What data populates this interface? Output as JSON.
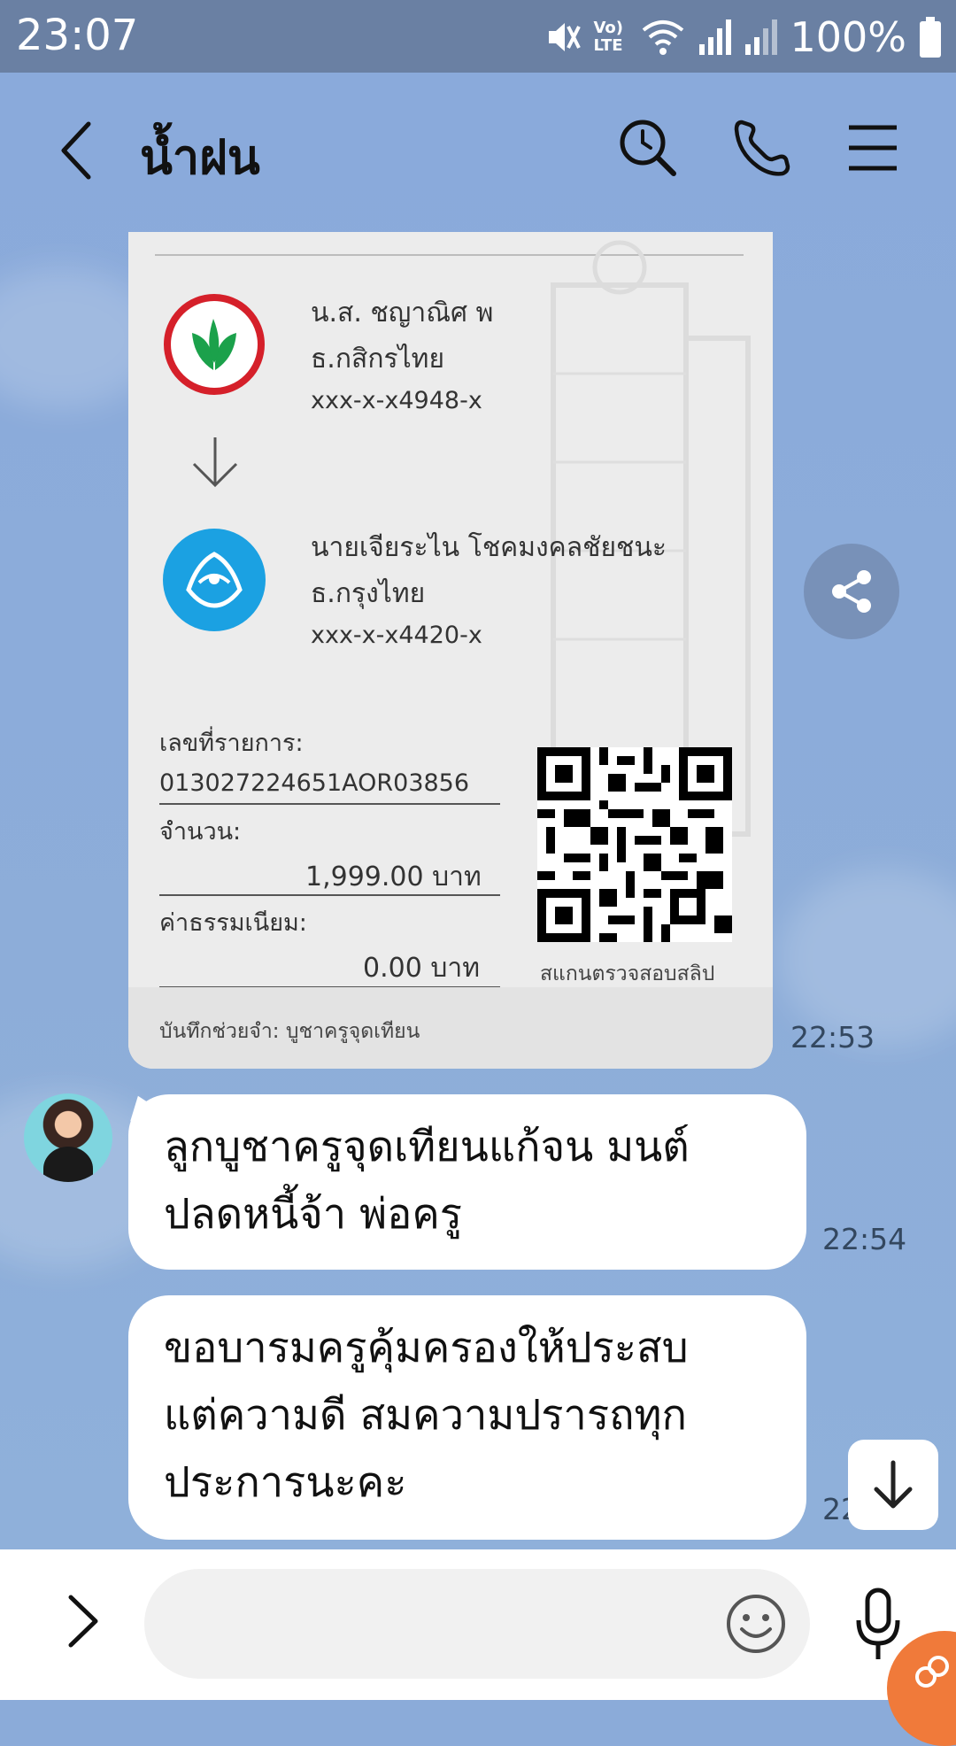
{
  "status_bar": {
    "time": "23:07",
    "network_label": "Vo) LTE",
    "battery": "100%",
    "icons": [
      "mute-icon",
      "volte-icon",
      "wifi-icon",
      "signal-icon",
      "signal-icon",
      "battery-icon"
    ]
  },
  "header": {
    "title": "น้ำฝน",
    "icons": [
      "back-icon",
      "search-icon",
      "phone-icon",
      "menu-icon"
    ]
  },
  "slip": {
    "sender": {
      "name": "น.ส. ชญาณิศ พ",
      "bank": "ธ.กสิกรไทย",
      "account": "xxx-x-x4948-x"
    },
    "receiver": {
      "name": "นายเจียระไน โชคมงคลชัยชนะ",
      "bank": "ธ.กรุงไทย",
      "account": "xxx-x-x4420-x"
    },
    "transaction_label": "เลขที่รายการ:",
    "transaction_id": "013027224651AOR03856",
    "amount_label": "จำนวน:",
    "amount": "1,999.00 บาท",
    "fee_label": "ค่าธรรมเนียม:",
    "fee": "0.00 บาท",
    "qr_caption": "สแกนตรวจสอบสลิป",
    "memo": "บันทึกช่วยจำ: บูชาครูจุดเทียน",
    "time": "22:53"
  },
  "messages": [
    {
      "lines": [
        "ลูกบูชาครูจุดเทียนแก้จน มนต์",
        "ปลดหนี้จ้า พ่อครู"
      ],
      "time": "22:54"
    },
    {
      "lines": [
        "ขอบารมครูคุ้มครองให้ประสบ",
        "แต่ความดี สมความปรารถทุก",
        "ประการนะคะ"
      ],
      "time": "22"
    }
  ],
  "colors": {
    "chat_background": "#8babd9",
    "status_bar": "#6a80a3",
    "kbank_green": "#1ba14b",
    "kbank_red": "#d5202a",
    "ktb_blue": "#1ba1e2",
    "accent_orange": "#f07a3a"
  }
}
